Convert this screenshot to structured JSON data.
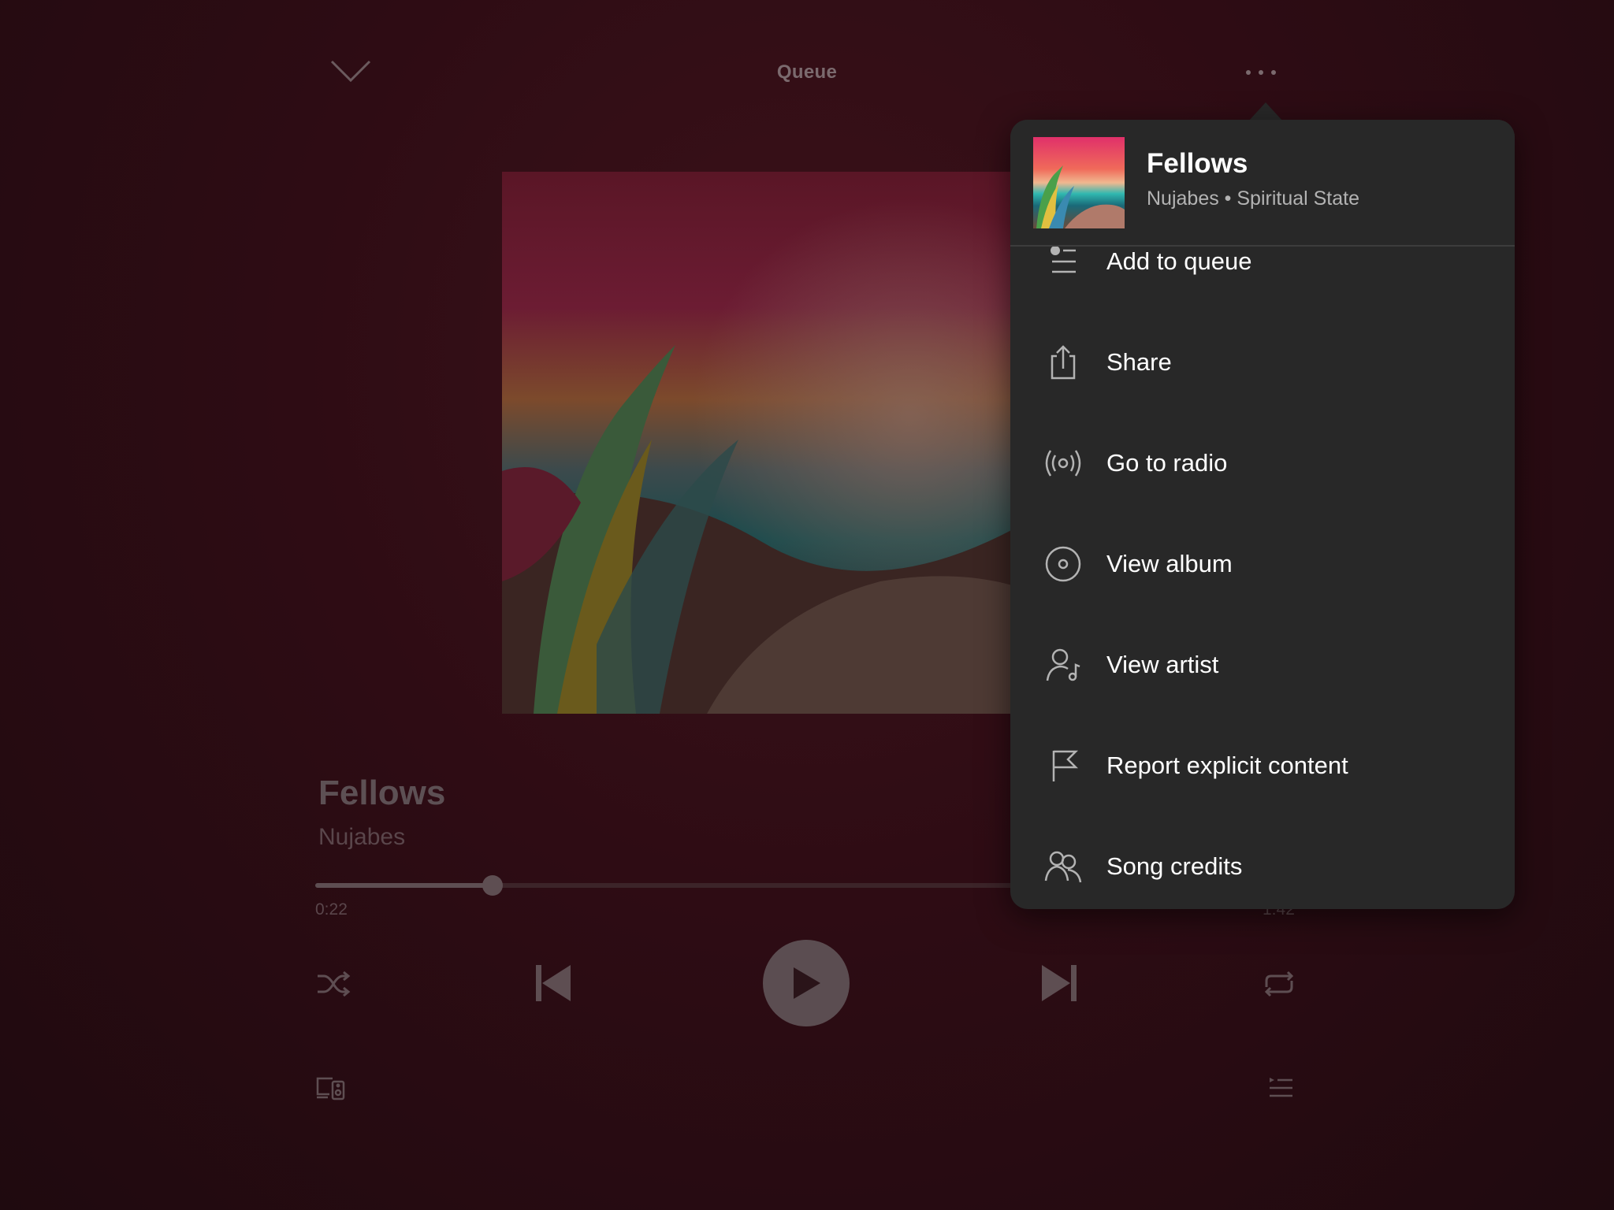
{
  "topbar": {
    "title": "Queue"
  },
  "now_playing": {
    "title": "Fellows",
    "artist": "Nujabes",
    "time_elapsed": "0:22",
    "time_total": "1:42",
    "progress": 0.18
  },
  "popover": {
    "title": "Fellows",
    "subtitle": "Nujabes • Spiritual State",
    "items": [
      {
        "label": "Add to queue",
        "icon": "add-to-queue-icon"
      },
      {
        "label": "Share",
        "icon": "share-icon"
      },
      {
        "label": "Go to radio",
        "icon": "radio-icon"
      },
      {
        "label": "View album",
        "icon": "album-icon"
      },
      {
        "label": "View artist",
        "icon": "artist-icon"
      },
      {
        "label": "Report explicit content",
        "icon": "flag-icon"
      },
      {
        "label": "Song credits",
        "icon": "credits-icon"
      }
    ]
  },
  "colors": {
    "popover_bg": "#282828",
    "background": "#2e0c14"
  }
}
